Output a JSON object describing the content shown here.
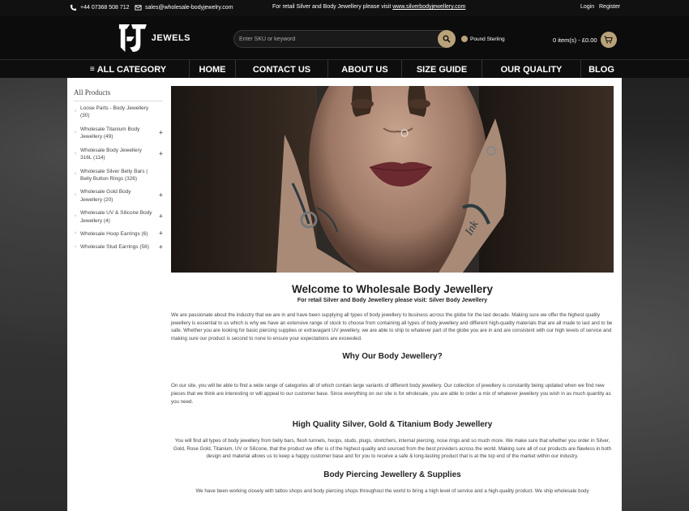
{
  "topbar": {
    "phone": "+44 07368 508 712",
    "email": "sales@wholesale-bodyjewelry.com",
    "promo_text": "For retail Silver and Body Jewellery please visit",
    "promo_link": "www.silverbodyjewellery.com",
    "login": "Login",
    "register": "Register"
  },
  "header": {
    "logo_text": "JEWELS",
    "search_placeholder": "Enter SKU or keyword",
    "currency": "Pound Sterling",
    "cart": "0 item(s) - £0.00"
  },
  "nav": {
    "items": [
      "ALL CATEGORY",
      "HOME",
      "CONTACT US",
      "ABOUT US",
      "SIZE GUIDE",
      "OUR QUALITY",
      "BLOG"
    ]
  },
  "sidebar": {
    "title": "All Products",
    "items": [
      {
        "label": "Loose Parts - Body Jewellery (30)",
        "expandable": false
      },
      {
        "label": "Wholesale Titanium Body Jewellery (49)",
        "expandable": true
      },
      {
        "label": "Wholesale Body Jewellery 316L (114)",
        "expandable": true
      },
      {
        "label": "Wholesale Silver Belly Bars | Belly Button Rings (326)",
        "expandable": false
      },
      {
        "label": "Wholesale Gold Body Jewellery (20)",
        "expandable": true
      },
      {
        "label": "Wholesale UV & Silicone Body Jewellery (4)",
        "expandable": true
      },
      {
        "label": "Wholesale Hoop Earrings (6)",
        "expandable": true
      },
      {
        "label": "Wholesale Stud Earrings (56)",
        "expandable": true
      }
    ]
  },
  "main": {
    "welcome": "Welcome to Wholesale Body Jewellery",
    "sub": "For retail Silver and Body Jewellery please visit: Silver Body Jewellery",
    "intro": "We are passionate about the industry that we are in and have been supplying all types of body jewellery to business across the globe for the last decade. Making sure we offer the highest quality jewellery is essential to us which is why we have an extensive range of stock to choose from containing all types of body jewellery and different high-quality materials that are all made to last and to be safe. Whether you are looking for basic piercing supplies or extravagant UV jewellery, we are able to ship to whatever part of the globe you are in and are consistent with our high levels of service and making sure our product is second to none to ensure your expectations are exceeded.",
    "why_heading": "Why Our Body Jewellery?",
    "why_text": "On our site, you will be able to find a wide range of categories all of which contain large variants of different body jewellery. Our collection of jewellery is constantly being updated when we find new pieces that we think are interesting or will appeal to our customer base. Since everything on our site is for wholesale, you are able to order a mix of whatever jewellery you wish in as much quantity as you need.",
    "quality_heading": "High Quality Silver, Gold & Titanium Body Jewellery",
    "quality_text": "You will find all types of body jewellery from belly bars, flesh tunnels, hoops, studs, plugs, stretchers, internal piercing, nose rings and so much more. We make sure that whether you order in Silver, Gold, Rose Gold, Titanium, UV or Silicone, that the product we offer is of the highest quality and sourced from the best providers across the world. Making sure all of our products are flawless in both design and material allows us to keep a happy customer base and for you to receive a safe & long-lasting product that is at the top end of the market within our industry.",
    "supplies_heading": "Body Piercing Jewellery & Supplies",
    "supplies_text": "We have been working closely with tattoo shops and body piercing shops throughout the world to bring a high level of service and a high-quality product. We ship wholesale body"
  },
  "colors": {
    "accent": "#b9a27a",
    "header_bg": "#0c0c0c",
    "content_bg": "#ffffff"
  }
}
